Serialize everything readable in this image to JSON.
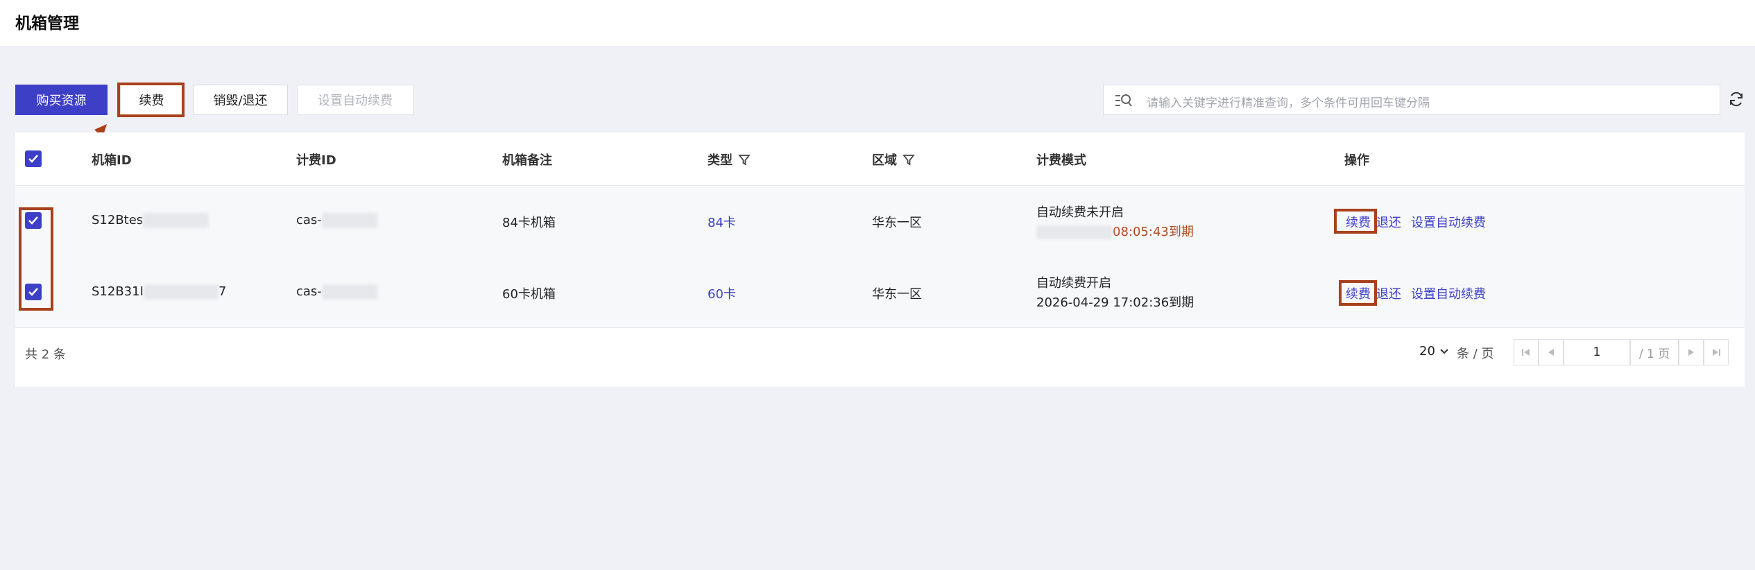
{
  "header": {
    "title": "机箱管理"
  },
  "toolbar": {
    "buy_label": "购买资源",
    "renew_label": "续费",
    "destroy_label": "销毁/退还",
    "auto_renew_label": "设置自动续费"
  },
  "search": {
    "placeholder": "请输入关键字进行精准查询，多个条件可用回车键分隔"
  },
  "table": {
    "columns": [
      "机箱ID",
      "计费ID",
      "机箱备注",
      "类型",
      "区域",
      "计费模式",
      "操作"
    ],
    "rows": [
      {
        "chassis_id": "S12Btes",
        "billing_id": "cas-",
        "remark": "84卡机箱",
        "type": "84卡",
        "region": "华东一区",
        "billing_mode": "自动续费未开启",
        "expire": "08:05:43到期",
        "actions": [
          "续费",
          "退还",
          "设置自动续费"
        ]
      },
      {
        "chassis_id": "S12B31I",
        "chassis_id_tail": "7",
        "billing_id": "cas-",
        "remark": "60卡机箱",
        "type": "60卡",
        "region": "华东一区",
        "billing_mode": "自动续费开启",
        "expire": "2026-04-29 17:02:36到期",
        "actions": [
          "续费",
          "退还",
          "设置自动续费"
        ]
      }
    ]
  },
  "pagination": {
    "total_text": "共 2 条",
    "page_size": "20",
    "per_page_text": "条 / 页",
    "current_page": "1",
    "total_pages_text": "/ 1 页"
  },
  "colors": {
    "accent": "#3d3fc7",
    "highlight": "#a8411c",
    "expire_warning": "#b24a1c"
  }
}
